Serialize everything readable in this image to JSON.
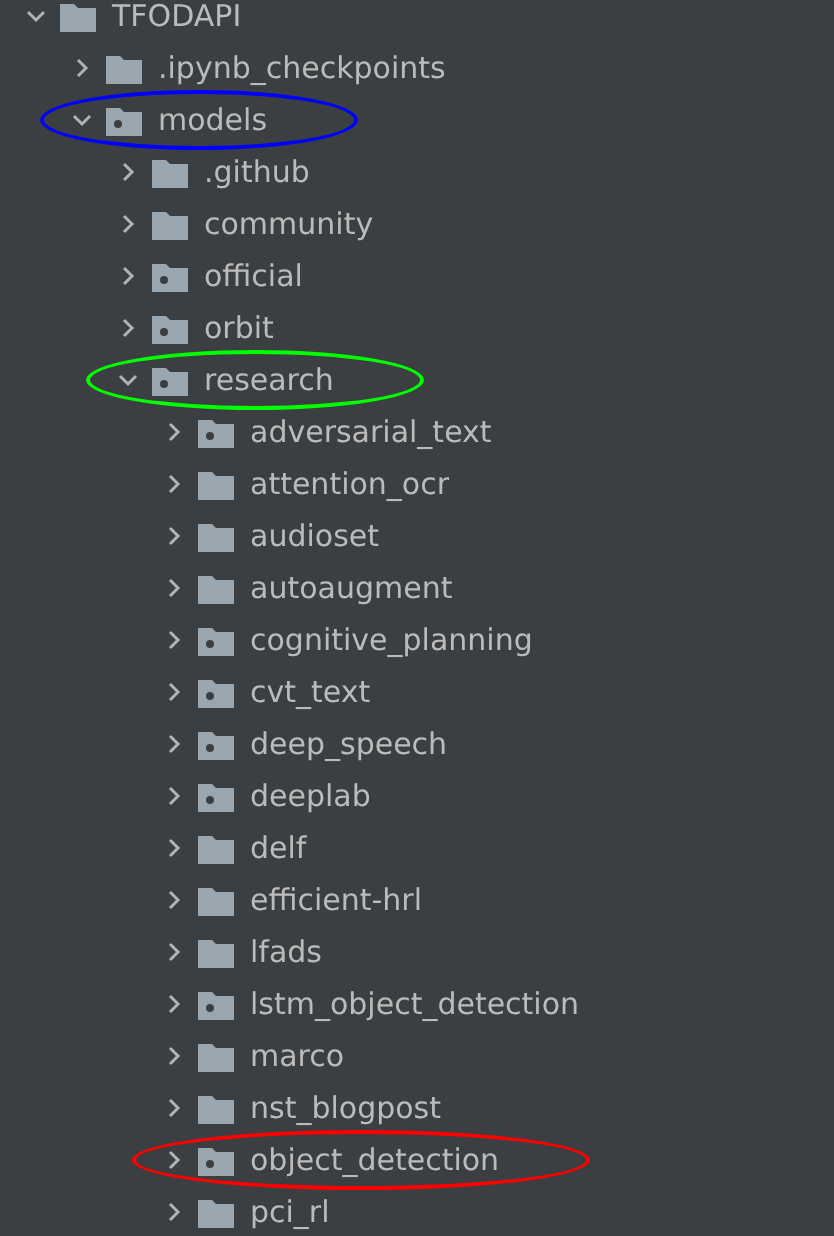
{
  "tree": [
    {
      "name": "TFODAPI",
      "kind": "folder",
      "expanded": true,
      "children": [
        {
          "name": ".ipynb_checkpoints",
          "kind": "folder",
          "expanded": false
        },
        {
          "name": "models",
          "kind": "package",
          "expanded": true,
          "color": "#0000ff",
          "children": [
            {
              "name": ".github",
              "kind": "folder",
              "expanded": false
            },
            {
              "name": "community",
              "kind": "folder",
              "expanded": false
            },
            {
              "name": "official",
              "kind": "package",
              "expanded": false
            },
            {
              "name": "orbit",
              "kind": "package",
              "expanded": false
            },
            {
              "name": "research",
              "kind": "package",
              "expanded": true,
              "color": "#00ff00",
              "children": [
                {
                  "name": "adversarial_text",
                  "kind": "package",
                  "expanded": false
                },
                {
                  "name": "attention_ocr",
                  "kind": "folder",
                  "expanded": false
                },
                {
                  "name": "audioset",
                  "kind": "folder",
                  "expanded": false
                },
                {
                  "name": "autoaugment",
                  "kind": "folder",
                  "expanded": false
                },
                {
                  "name": "cognitive_planning",
                  "kind": "package",
                  "expanded": false
                },
                {
                  "name": "cvt_text",
                  "kind": "package",
                  "expanded": false
                },
                {
                  "name": "deep_speech",
                  "kind": "package",
                  "expanded": false
                },
                {
                  "name": "deeplab",
                  "kind": "package",
                  "expanded": false
                },
                {
                  "name": "delf",
                  "kind": "folder",
                  "expanded": false
                },
                {
                  "name": "efficient-hrl",
                  "kind": "folder",
                  "expanded": false
                },
                {
                  "name": "lfads",
                  "kind": "folder",
                  "expanded": false
                },
                {
                  "name": "lstm_object_detection",
                  "kind": "package",
                  "expanded": false
                },
                {
                  "name": "marco",
                  "kind": "folder",
                  "expanded": false
                },
                {
                  "name": "nst_blogpost",
                  "kind": "folder",
                  "expanded": false
                },
                {
                  "name": "object_detection",
                  "kind": "package",
                  "expanded": false,
                  "color": "#ff0000"
                },
                {
                  "name": "pci_rl",
                  "kind": "folder",
                  "expanded": false
                }
              ]
            }
          ]
        }
      ]
    }
  ]
}
